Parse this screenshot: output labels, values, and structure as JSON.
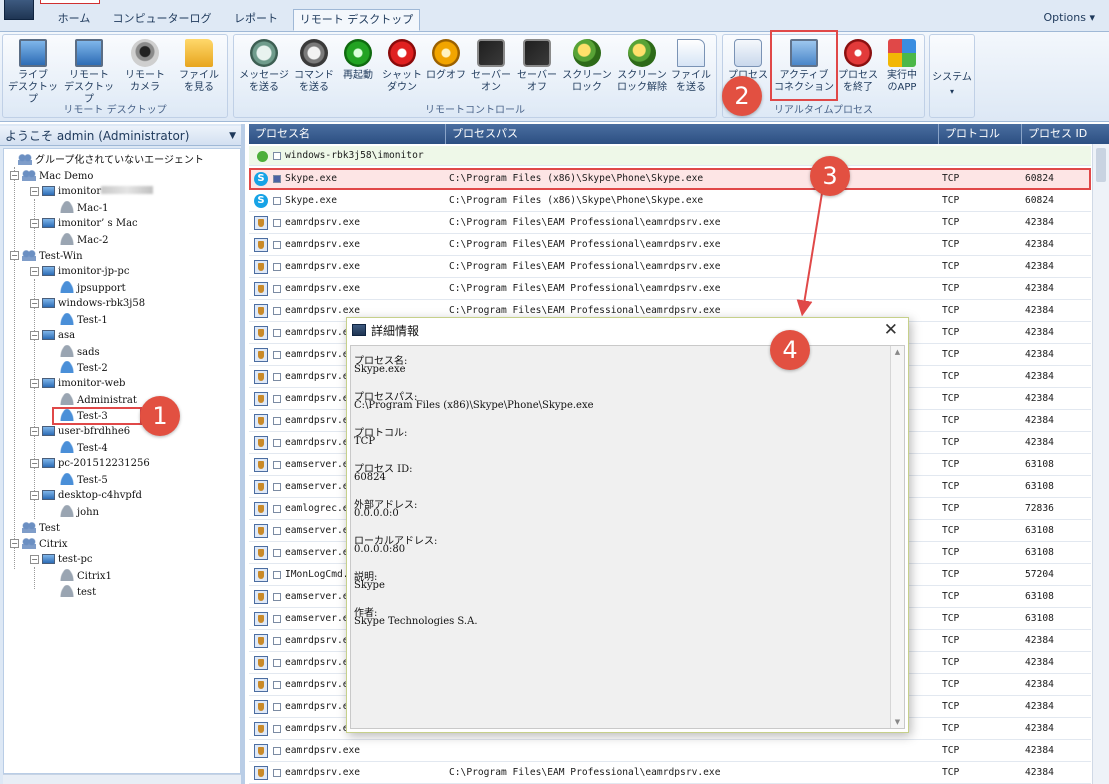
{
  "tabs": [
    {
      "label": "ホーム"
    },
    {
      "label": "コンピューターログ"
    },
    {
      "label": "レポート"
    },
    {
      "label": "リモート デスクトップ"
    }
  ],
  "options_label": "Options",
  "ribbon": {
    "groups": [
      {
        "label": "リモート デスクトップ",
        "buttons": [
          {
            "label": "ライブ\nデスクトップ",
            "icon": "live-desktop-icon"
          },
          {
            "label": "リモート\nデスクトップ",
            "icon": "remote-desktop-icon"
          },
          {
            "label": "リモート\nカメラ",
            "icon": "camera-icon"
          },
          {
            "label": "ファイル\nを見る",
            "icon": "folder-icon"
          }
        ]
      },
      {
        "label": "リモートコントロール",
        "buttons": [
          {
            "label": "メッセージ\nを送る",
            "icon": "message-icon"
          },
          {
            "label": "コマンド\nを送る",
            "icon": "command-icon"
          },
          {
            "label": "再起動",
            "icon": "restart-icon"
          },
          {
            "label": "シャット\nダウン",
            "icon": "shutdown-icon"
          },
          {
            "label": "ログオフ",
            "icon": "logoff-icon"
          },
          {
            "label": "セーバー\nオン",
            "icon": "screensaver-on-icon"
          },
          {
            "label": "セーバー\nオフ",
            "icon": "screensaver-off-icon"
          },
          {
            "label": "スクリーン\nロック",
            "icon": "screen-lock-icon"
          },
          {
            "label": "スクリーン\nロック解除",
            "icon": "screen-unlock-icon"
          },
          {
            "label": "ファイル\nを送る",
            "icon": "send-file-icon"
          }
        ]
      },
      {
        "label": "リアルタイムプロセス",
        "buttons": [
          {
            "label": "プロセス",
            "icon": "process-icon"
          },
          {
            "label": "アクティブ\nコネクション",
            "icon": "active-connection-icon"
          },
          {
            "label": "プロセス\nを終了",
            "icon": "kill-process-icon"
          },
          {
            "label": "実行中\nのAPP",
            "icon": "running-apps-icon"
          }
        ]
      },
      {
        "label": "",
        "buttons": [
          {
            "label": "システム",
            "icon": "system-icon"
          }
        ]
      }
    ]
  },
  "left_header": "ようこそ admin (Administrator)",
  "tree": [
    {
      "label": "グループ化されていないエージェント",
      "type": "group"
    },
    {
      "label": "Mac Demo",
      "type": "group"
    },
    {
      "label": "imonitor",
      "type": "pc"
    },
    {
      "label": "Mac-1",
      "type": "user-grey"
    },
    {
      "label": "imonitor’ s Mac",
      "type": "pc"
    },
    {
      "label": "Mac-2",
      "type": "user-grey"
    },
    {
      "label": "Test-Win",
      "type": "group"
    },
    {
      "label": "imonitor-jp-pc",
      "type": "pc"
    },
    {
      "label": "jpsupport",
      "type": "user"
    },
    {
      "label": "windows-rbk3j58",
      "type": "pc"
    },
    {
      "label": "Test-1",
      "type": "user"
    },
    {
      "label": "asa",
      "type": "pc"
    },
    {
      "label": "sads",
      "type": "user-grey"
    },
    {
      "label": "Test-2",
      "type": "user"
    },
    {
      "label": "imonitor-web",
      "type": "pc"
    },
    {
      "label": "Administrat",
      "type": "user-grey"
    },
    {
      "label": "Test-3",
      "type": "user"
    },
    {
      "label": "user-bfrdhhe6",
      "type": "pc"
    },
    {
      "label": "Test-4",
      "type": "user"
    },
    {
      "label": "pc-201512231256",
      "type": "pc"
    },
    {
      "label": "Test-5",
      "type": "user"
    },
    {
      "label": "desktop-c4hvpfd",
      "type": "pc"
    },
    {
      "label": "john",
      "type": "user-grey"
    },
    {
      "label": "Test",
      "type": "group"
    },
    {
      "label": "Citrix",
      "type": "group"
    },
    {
      "label": "test-pc",
      "type": "pc"
    },
    {
      "label": "Citrix1",
      "type": "user-grey"
    },
    {
      "label": "test",
      "type": "user-grey"
    }
  ],
  "grid": {
    "headers": [
      "プロセス名",
      "プロセスパス",
      "プロトコル",
      "プロセス ID"
    ],
    "group_label": "windows-rbk3j58\\imonitor",
    "rows": [
      {
        "name": "Skype.exe",
        "path": "C:\\Program Files (x86)\\Skype\\Phone\\Skype.exe",
        "proto": "TCP",
        "pid": "60824",
        "icon": "skype"
      },
      {
        "name": "Skype.exe",
        "path": "C:\\Program Files (x86)\\Skype\\Phone\\Skype.exe",
        "proto": "TCP",
        "pid": "60824",
        "icon": "skype"
      },
      {
        "name": "eamrdpsrv.exe",
        "path": "C:\\Program Files\\EAM Professional\\eamrdpsrv.exe",
        "proto": "TCP",
        "pid": "42384",
        "icon": "eam"
      },
      {
        "name": "eamrdpsrv.exe",
        "path": "C:\\Program Files\\EAM Professional\\eamrdpsrv.exe",
        "proto": "TCP",
        "pid": "42384",
        "icon": "eam"
      },
      {
        "name": "eamrdpsrv.exe",
        "path": "C:\\Program Files\\EAM Professional\\eamrdpsrv.exe",
        "proto": "TCP",
        "pid": "42384",
        "icon": "eam"
      },
      {
        "name": "eamrdpsrv.exe",
        "path": "C:\\Program Files\\EAM Professional\\eamrdpsrv.exe",
        "proto": "TCP",
        "pid": "42384",
        "icon": "eam"
      },
      {
        "name": "eamrdpsrv.exe",
        "path": "C:\\Program Files\\EAM Professional\\eamrdpsrv.exe",
        "proto": "TCP",
        "pid": "42384",
        "icon": "eam"
      },
      {
        "name": "eamrdpsrv.exe",
        "path": "",
        "proto": "TCP",
        "pid": "42384",
        "icon": "eam"
      },
      {
        "name": "eamrdpsrv.exe",
        "path": "",
        "proto": "TCP",
        "pid": "42384",
        "icon": "eam"
      },
      {
        "name": "eamrdpsrv.exe",
        "path": "",
        "proto": "TCP",
        "pid": "42384",
        "icon": "eam"
      },
      {
        "name": "eamrdpsrv.exe",
        "path": "",
        "proto": "TCP",
        "pid": "42384",
        "icon": "eam"
      },
      {
        "name": "eamrdpsrv.exe",
        "path": "",
        "proto": "TCP",
        "pid": "42384",
        "icon": "eam"
      },
      {
        "name": "eamrdpsrv.exe",
        "path": "",
        "proto": "TCP",
        "pid": "42384",
        "icon": "eam"
      },
      {
        "name": "eamserver.exe",
        "path": "",
        "proto": "TCP",
        "pid": "63108",
        "icon": "eam"
      },
      {
        "name": "eamserver.exe",
        "path": "",
        "proto": "TCP",
        "pid": "63108",
        "icon": "eam"
      },
      {
        "name": "eamlogrec.exe",
        "path": "",
        "proto": "TCP",
        "pid": "72836",
        "icon": "eam"
      },
      {
        "name": "eamserver.exe",
        "path": "",
        "proto": "TCP",
        "pid": "63108",
        "icon": "eam"
      },
      {
        "name": "eamserver.exe",
        "path": "",
        "proto": "TCP",
        "pid": "63108",
        "icon": "eam"
      },
      {
        "name": "IMonLogCmd.exe",
        "path": "",
        "proto": "TCP",
        "pid": "57204",
        "icon": "eam"
      },
      {
        "name": "eamserver.exe",
        "path": "",
        "proto": "TCP",
        "pid": "63108",
        "icon": "eam"
      },
      {
        "name": "eamserver.exe",
        "path": "",
        "proto": "TCP",
        "pid": "63108",
        "icon": "eam"
      },
      {
        "name": "eamrdpsrv.exe",
        "path": "",
        "proto": "TCP",
        "pid": "42384",
        "icon": "eam"
      },
      {
        "name": "eamrdpsrv.exe",
        "path": "",
        "proto": "TCP",
        "pid": "42384",
        "icon": "eam"
      },
      {
        "name": "eamrdpsrv.exe",
        "path": "",
        "proto": "TCP",
        "pid": "42384",
        "icon": "eam"
      },
      {
        "name": "eamrdpsrv.exe",
        "path": "",
        "proto": "TCP",
        "pid": "42384",
        "icon": "eam"
      },
      {
        "name": "eamrdpsrv.exe",
        "path": "",
        "proto": "TCP",
        "pid": "42384",
        "icon": "eam"
      },
      {
        "name": "eamrdpsrv.exe",
        "path": "",
        "proto": "TCP",
        "pid": "42384",
        "icon": "eam"
      },
      {
        "name": "eamrdpsrv.exe",
        "path": "C:\\Program Files\\EAM Professional\\eamrdpsrv.exe",
        "proto": "TCP",
        "pid": "42384",
        "icon": "eam"
      },
      {
        "name": "eamrdpsrv.exe",
        "path": "C:\\Program Files\\EAM Professional\\eamrdpsrv.exe",
        "proto": "TCP",
        "pid": "42384",
        "icon": "eam"
      }
    ]
  },
  "dialog": {
    "title": "詳細情報",
    "fields": [
      {
        "label": "プロセス名:",
        "value": "Skype.exe"
      },
      {
        "label": "プロセスパス:",
        "value": "C:\\Program Files (x86)\\Skype\\Phone\\Skype.exe"
      },
      {
        "label": "プロトコル:",
        "value": "TCP"
      },
      {
        "label": "プロセス ID:",
        "value": "60824"
      },
      {
        "label": "外部アドレス:",
        "value": "0.0.0.0:0"
      },
      {
        "label": "ローカルアドレス:",
        "value": "0.0.0.0:80"
      },
      {
        "label": "説明:",
        "value": "Skype"
      },
      {
        "label": "作者:",
        "value": "Skype Technologies S.A."
      }
    ]
  },
  "annotations": [
    "1",
    "2",
    "3",
    "4"
  ],
  "colors": {
    "highlight": "#e04848",
    "header": "#2c4f82",
    "badge": "#e25041"
  }
}
